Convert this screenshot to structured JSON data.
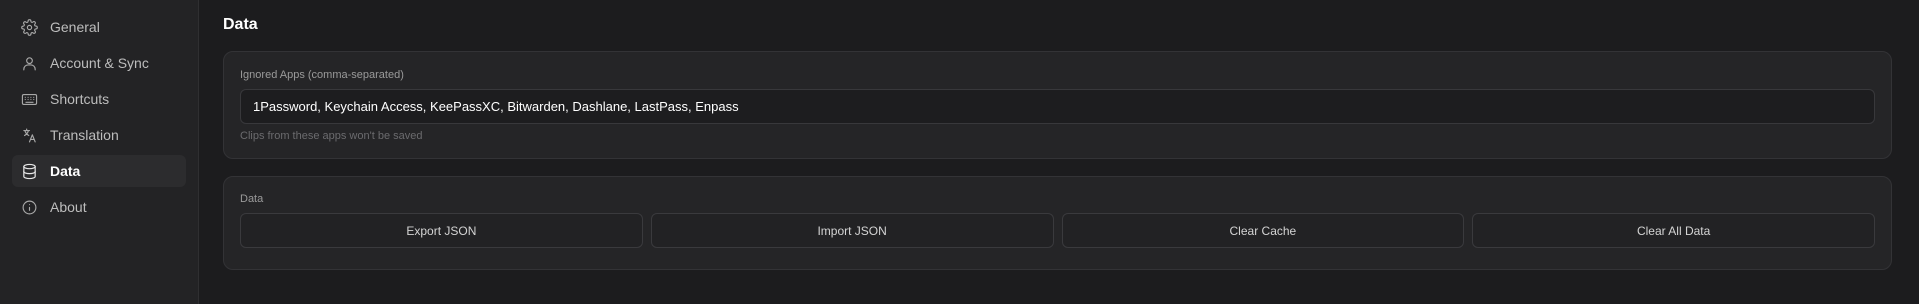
{
  "sidebar": {
    "items": [
      {
        "label": "General",
        "icon": "gear-icon"
      },
      {
        "label": "Account & Sync",
        "icon": "user-icon"
      },
      {
        "label": "Shortcuts",
        "icon": "keyboard-icon"
      },
      {
        "label": "Translation",
        "icon": "translate-icon"
      },
      {
        "label": "Data",
        "icon": "database-icon",
        "active": true
      },
      {
        "label": "About",
        "icon": "info-icon"
      }
    ]
  },
  "main": {
    "title": "Data",
    "ignored_apps": {
      "label": "Ignored Apps (comma-separated)",
      "value": "1Password, Keychain Access, KeePassXC, Bitwarden, Dashlane, LastPass, Enpass",
      "hint": "Clips from these apps won't be saved"
    },
    "data_section": {
      "label": "Data",
      "buttons": {
        "export": "Export JSON",
        "import": "Import JSON",
        "clear_cache": "Clear Cache",
        "clear_all": "Clear All Data"
      }
    }
  },
  "colors": {
    "background": "#1c1c1e",
    "sidebar": "#232325",
    "card": "#252527",
    "active_item": "#2c2c2e"
  }
}
